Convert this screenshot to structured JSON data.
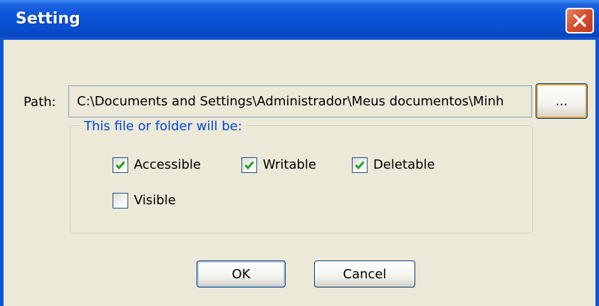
{
  "window": {
    "title": "Setting"
  },
  "path": {
    "label": "Path:",
    "value": "C:\\Documents and Settings\\Administrador\\Meus documentos\\Minh",
    "browse_label": "..."
  },
  "group": {
    "legend": "This file or folder will be:",
    "options": [
      {
        "label": "Accessible",
        "checked": true
      },
      {
        "label": "Writable",
        "checked": true
      },
      {
        "label": "Deletable",
        "checked": true
      },
      {
        "label": "Visible",
        "checked": false
      }
    ]
  },
  "buttons": {
    "ok": "OK",
    "cancel": "Cancel"
  },
  "colors": {
    "titlebar": "#0A55D8",
    "face": "#ECE9D8",
    "check": "#21A121",
    "legend": "#0046D5",
    "close": "#D4502E"
  }
}
